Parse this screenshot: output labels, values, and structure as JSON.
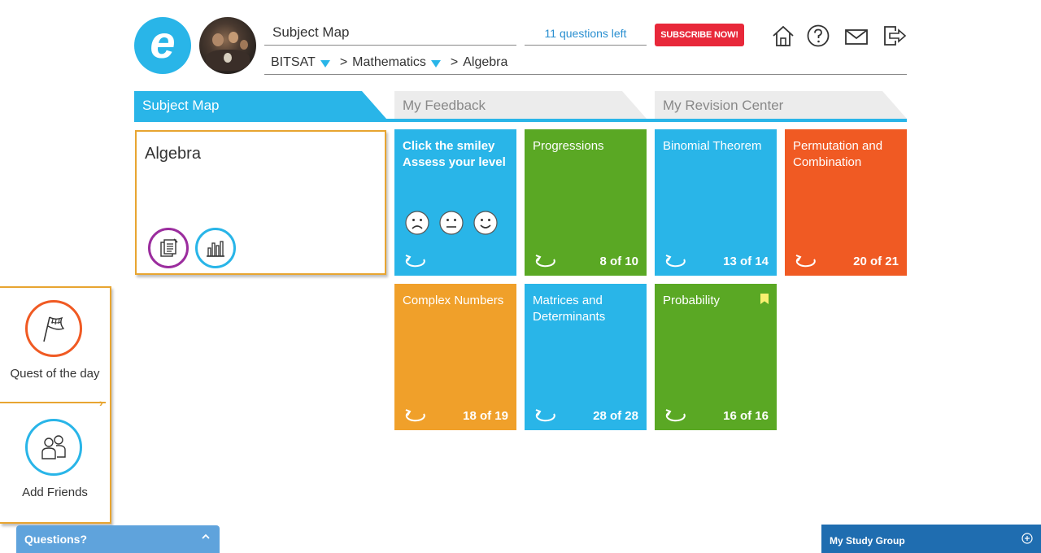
{
  "header": {
    "logo_letter": "e",
    "title": "Subject Map",
    "questions_left": "11 questions left",
    "subscribe_label": "SUBSCRIBE NOW!",
    "icons": [
      "home-icon",
      "help-icon",
      "mail-icon",
      "logout-icon"
    ]
  },
  "breadcrumb": {
    "items": [
      "BITSAT",
      "Mathematics",
      "Algebra"
    ],
    "separator": ">"
  },
  "tabs": [
    {
      "label": "Subject Map",
      "active": true
    },
    {
      "label": "My Feedback",
      "active": false
    },
    {
      "label": "My Revision Center",
      "active": false
    }
  ],
  "subject_card": {
    "title": "Algebra",
    "buttons": [
      "notes-icon",
      "bar-chart-icon"
    ]
  },
  "smiley_tile": {
    "line1": "Click the smiley",
    "line2": "Assess your level"
  },
  "tiles": [
    {
      "name": "Progressions",
      "count": "8 of 10",
      "color": "#5aa824"
    },
    {
      "name": "Binomial Theorem",
      "count": "13 of 14",
      "color": "#29b5e8"
    },
    {
      "name": "Permutation and Combination",
      "count": "20 of 21",
      "color": "#f05a23"
    },
    {
      "name": "Complex Numbers",
      "count": "18 of 19",
      "color": "#f0a02a"
    },
    {
      "name": "Matrices and Determinants",
      "count": "28 of 28",
      "color": "#29b5e8"
    },
    {
      "name": "Probability",
      "count": "16 of 16",
      "color": "#5aa824",
      "bookmarked": true
    }
  ],
  "side_panel": {
    "quest_label": "Quest of the day",
    "friends_label": "Add Friends"
  },
  "bottom": {
    "questions_label": "Questions?",
    "study_group_label": "My Study Group"
  },
  "colors": {
    "accent": "#29b5e8",
    "subscribe": "#e8283a",
    "highlight_border": "#e8a531"
  }
}
